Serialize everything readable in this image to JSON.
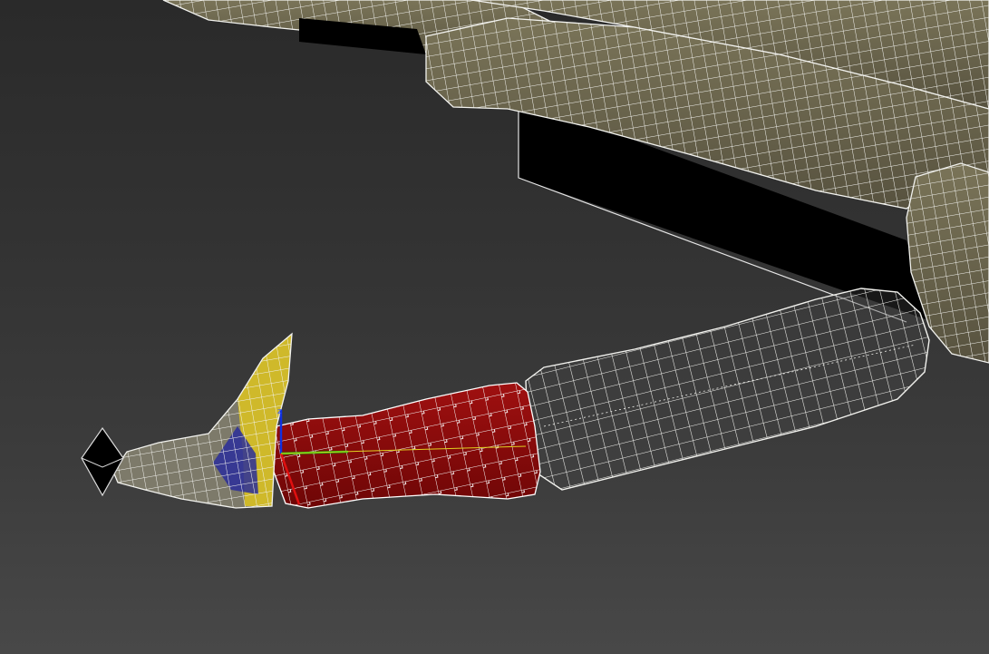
{
  "viewport": {
    "background_top": "#2a2a2a",
    "background_bottom": "#484848"
  },
  "scene": {
    "mesh_fill": "#6b6650",
    "mesh_fill_dark": "#5a5542",
    "wire_color": "#f2f2ee",
    "selected_fill": "#8b0a0a",
    "skin_weight_yellow": "#d8c024",
    "skin_weight_blue": "#2a2e9a",
    "helper_block": "#000000",
    "gizmo_x": "#e01010",
    "gizmo_y": "#10c010",
    "gizmo_z": "#1030e0",
    "gizmo_axis_label": "z"
  }
}
